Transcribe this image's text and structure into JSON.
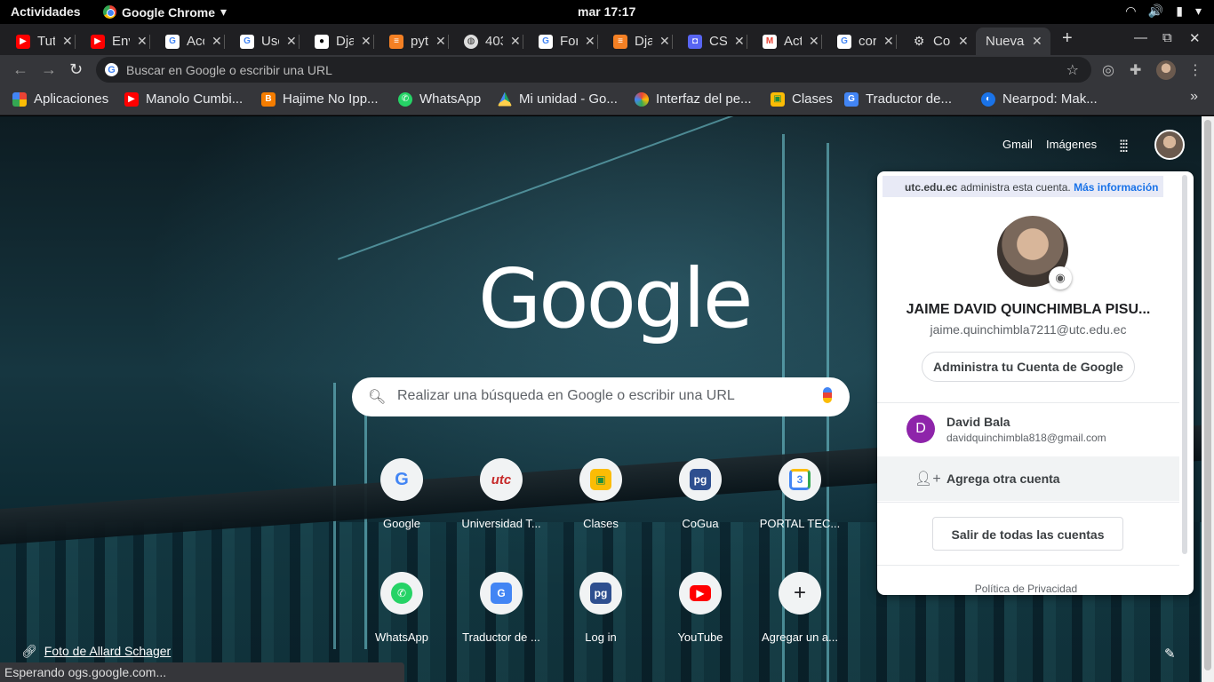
{
  "system": {
    "activities": "Actividades",
    "app_name": "Google Chrome",
    "clock": "mar 17:17"
  },
  "tabs": [
    {
      "label": "Tut",
      "icon": "youtube-icon",
      "color": "#ff0000"
    },
    {
      "label": "Env",
      "icon": "youtube-icon",
      "color": "#ff0000"
    },
    {
      "label": "Acc",
      "icon": "google-icon",
      "color": "#4285f4"
    },
    {
      "label": "Usc",
      "icon": "google-icon",
      "color": "#4285f4"
    },
    {
      "label": "Dja",
      "icon": "medium-icon",
      "color": "#000000"
    },
    {
      "label": "pyt",
      "icon": "stackoverflow-icon",
      "color": "#f48024"
    },
    {
      "label": "403",
      "icon": "globe-icon",
      "color": "#dddddd"
    },
    {
      "label": "For",
      "icon": "google-icon",
      "color": "#4285f4"
    },
    {
      "label": "Dja",
      "icon": "stackoverflow-icon",
      "color": "#f48024"
    },
    {
      "label": "CSI",
      "icon": "discord-icon",
      "color": "#5865f2"
    },
    {
      "label": "Act",
      "icon": "gmail-icon",
      "color": "#ea4335"
    },
    {
      "label": "cor",
      "icon": "google-icon",
      "color": "#4285f4"
    },
    {
      "label": "Co",
      "icon": "settings-icon",
      "color": "#dddddd"
    },
    {
      "label": "Nueva",
      "icon": "",
      "color": "",
      "active": true
    }
  ],
  "omnibox": {
    "placeholder": "Buscar en Google o escribir una URL"
  },
  "bookmarks": [
    {
      "label": "Aplicaciones",
      "icon": "apps-grid-icon",
      "color": "#ea4335"
    },
    {
      "label": "Manolo Cumbi...",
      "icon": "youtube-icon",
      "color": "#ff0000"
    },
    {
      "label": "Hajime No Ipp...",
      "icon": "blogger-icon",
      "color": "#f57d00"
    },
    {
      "label": "WhatsApp",
      "icon": "whatsapp-icon",
      "color": "#25d366"
    },
    {
      "label": "Mi unidad - Go...",
      "icon": "drive-icon",
      "color": "#1fa463"
    },
    {
      "label": "Interfaz del pe...",
      "icon": "rainbow-icon",
      "color": "#fbbc05"
    },
    {
      "label": "Clases",
      "icon": "classroom-icon",
      "color": "#1e8e3e"
    },
    {
      "label": "Traductor de...",
      "icon": "translate-icon",
      "color": "#4285f4"
    },
    {
      "label": "Nearpod: Mak...",
      "icon": "nearpod-icon",
      "color": "#1a73e8"
    }
  ],
  "ntp": {
    "gmail": "Gmail",
    "images": "Imágenes",
    "logo": "Google",
    "search_placeholder": "Realizar una búsqueda en Google o escribir una URL",
    "credit_text": "Foto de Allard Schager",
    "status_text": "Esperando ogs.google.com..."
  },
  "shortcuts": [
    {
      "label": "Google",
      "glyph": "G",
      "color": "#4285f4"
    },
    {
      "label": "Universidad T...",
      "glyph": "utc",
      "color": "#c62828"
    },
    {
      "label": "Clases",
      "glyph": "▣",
      "color": "#1e8e3e"
    },
    {
      "label": "CoGua",
      "glyph": "pg",
      "color": "#2e4f8f"
    },
    {
      "label": "PORTAL TEC...",
      "glyph": "3",
      "color": "#4285f4"
    },
    {
      "label": "WhatsApp",
      "glyph": "✆",
      "color": "#25d366"
    },
    {
      "label": "Traductor de ...",
      "glyph": "G",
      "color": "#4285f4"
    },
    {
      "label": "Log in",
      "glyph": "pg",
      "color": "#2e4f8f"
    },
    {
      "label": "YouTube",
      "glyph": "▶",
      "color": "#ff0000"
    },
    {
      "label": "Agregar un a...",
      "glyph": "+",
      "color": "#202124"
    }
  ],
  "account": {
    "domain": "utc.edu.ec",
    "managed_text": "administra esta cuenta.",
    "more_info": "Más información",
    "name": "JAIME DAVID QUINCHIMBLA PISU...",
    "email": "jaime.quinchimbla7211@utc.edu.ec",
    "manage_button": "Administra tu Cuenta de Google",
    "other_account": {
      "initial": "D",
      "name": "David Bala",
      "email": "davidquinchimbla818@gmail.com"
    },
    "add_account": "Agrega otra cuenta",
    "sign_out": "Salir de todas las cuentas",
    "privacy": "Política de Privacidad"
  }
}
